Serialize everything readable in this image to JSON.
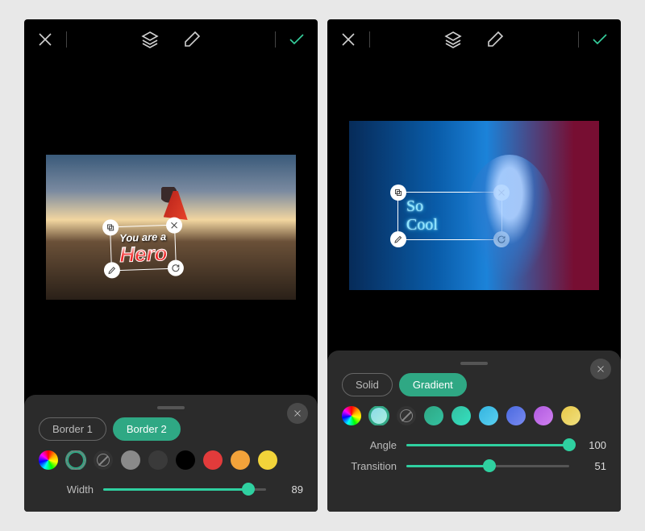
{
  "left": {
    "text": {
      "line1": "You are a",
      "line2": "Hero"
    },
    "panel": {
      "tabs": [
        "Border 1",
        "Border 2"
      ],
      "active_tab": 1,
      "swatches": [
        "#rainbow",
        "#hollow",
        "#none",
        "#8a8a8a",
        "#3a3a3a",
        "#000000",
        "#e23b3b",
        "#f2a23a",
        "#f2d43a"
      ],
      "sliders": [
        {
          "label": "Width",
          "value": 89,
          "pct": 89
        }
      ]
    }
  },
  "right": {
    "text": {
      "line1": "So",
      "line2": "Cool"
    },
    "panel": {
      "tabs": [
        "Solid",
        "Gradient"
      ],
      "active_tab": 1,
      "swatches": [
        "#rainbow",
        "#87d8e8",
        "#none",
        "#2fa884",
        "#34c0a0",
        "#34b4e0",
        "#4a6ae0",
        "#b05ae0",
        "#e8c848"
      ],
      "sliders": [
        {
          "label": "Angle",
          "value": 100,
          "pct": 100
        },
        {
          "label": "Transition",
          "value": 51,
          "pct": 51
        }
      ]
    }
  }
}
